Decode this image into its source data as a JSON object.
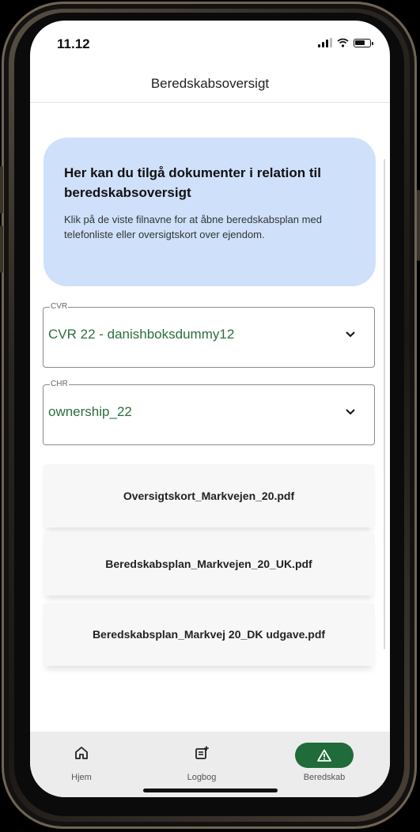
{
  "status_bar": {
    "time": "11.12",
    "icons": [
      "signal-icon",
      "wifi-icon",
      "battery-icon"
    ]
  },
  "header": {
    "title": "Beredskabsoversigt"
  },
  "info_card": {
    "title": "Her kan du tilgå dokumenter i relation til beredskabsoversigt",
    "body": "Klik på de viste filnavne for at åbne beredskabsplan med telefonliste eller oversigtskort over ejendom."
  },
  "cvr_select": {
    "label": "CVR",
    "value": "CVR 22 - danishboksdummy12"
  },
  "chr_select": {
    "label": "CHR",
    "value": "ownership_22"
  },
  "files": [
    {
      "name": "Oversigtskort_Markvejen_20.pdf"
    },
    {
      "name": "Beredskabsplan_Markvejen_20_UK.pdf"
    },
    {
      "name": "Beredskabsplan_Markvej 20_DK udgave.pdf"
    }
  ],
  "bottom_nav": [
    {
      "label": "Hjem",
      "icon": "home-icon"
    },
    {
      "label": "Logbog",
      "icon": "logbook-icon"
    },
    {
      "label": "Beredskab",
      "icon": "warning-icon",
      "active": true
    }
  ],
  "colors": {
    "accent": "#1f6b3a",
    "info_card_bg": "#cfe0fb",
    "select_text": "#2c6e3f"
  }
}
